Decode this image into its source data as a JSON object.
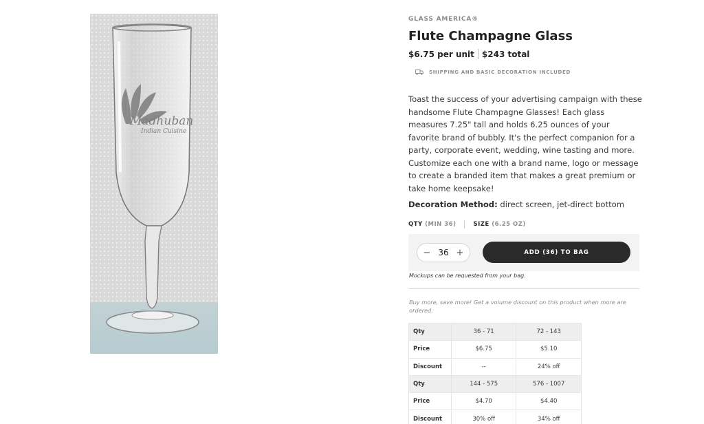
{
  "product": {
    "brand": "GLASS AMERICA®",
    "title": "Flute Champagne Glass",
    "price_per_unit": "$6.75 per unit",
    "price_total": "$243 total",
    "shipping_note": "SHIPPING AND BASIC DECORATION INCLUDED",
    "description": "Toast the success of your advertising campaign with these handsome Flute Champagne Glasses! Each glass measures 7.25\" tall and holds 6.25 ounces of your favorite brand of bubbly. It's the perfect companion for a party, corporate event, wedding, wine tasting and more. Customize each one with a brand name, logo or message to create a branded item that makes a great premium or take home keepsake!",
    "decoration_label": "Decoration Method:",
    "decoration_value": " direct screen, jet-direct bottom",
    "image_logo_text": "Madhuban",
    "image_logo_sub": "Indian Cuisine"
  },
  "options": {
    "qty_label": "QTY",
    "qty_hint": "(MIN 36)",
    "size_label": "SIZE",
    "size_hint": "(6.25 OZ)"
  },
  "cart": {
    "minus": "−",
    "quantity": "36",
    "plus": "+",
    "add_label": "ADD (36) TO BAG",
    "mockups_note": "Mockups can be requested from your bag."
  },
  "volume": {
    "note": "Buy more, save more! Get a volume discount on this product when more are ordered.",
    "rows": [
      {
        "label": "Qty",
        "cells": [
          "36 - 71",
          "72 - 143"
        ],
        "header": true
      },
      {
        "label": "Price",
        "cells": [
          "$6.75",
          "$5.10"
        ]
      },
      {
        "label": "Discount",
        "cells": [
          "--",
          "24% off"
        ]
      },
      {
        "label": "Qty",
        "cells": [
          "144 - 575",
          "576 - 1007"
        ],
        "header": true
      },
      {
        "label": "Price",
        "cells": [
          "$4.70",
          "$4.40"
        ]
      },
      {
        "label": "Discount",
        "cells": [
          "30% off",
          "34% off"
        ]
      }
    ]
  },
  "colors": {
    "button_bg": "#2a2a2a",
    "muted_text": "#8f8f8f",
    "table_header_bg": "#eeeeee"
  }
}
